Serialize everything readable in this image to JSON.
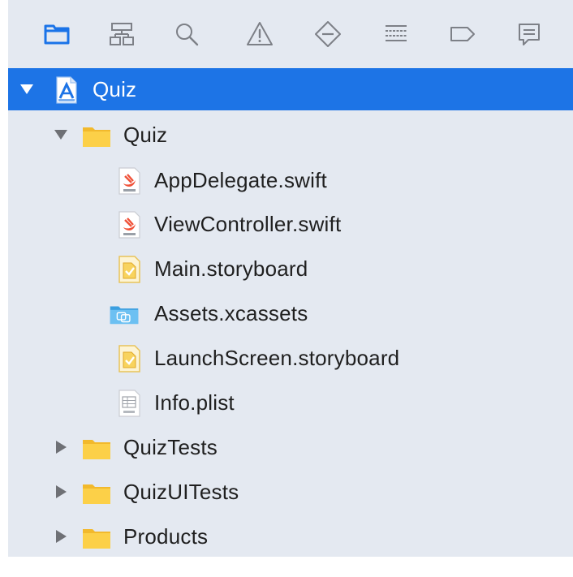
{
  "toolbar": {
    "tabs": [
      {
        "icon": "folder-icon",
        "active": true
      },
      {
        "icon": "hierarchy-icon",
        "active": false
      },
      {
        "icon": "search-icon",
        "active": false
      },
      {
        "icon": "warning-icon",
        "active": false
      },
      {
        "icon": "test-diamond-icon",
        "active": false
      },
      {
        "icon": "debug-list-icon",
        "active": false
      },
      {
        "icon": "breakpoint-icon",
        "active": false
      },
      {
        "icon": "report-message-icon",
        "active": false
      }
    ],
    "active_color": "#1a73e8",
    "inactive_color": "#7d8087"
  },
  "tree": {
    "project": {
      "label": "Quiz",
      "icon": "xcode-project-icon",
      "expanded": true,
      "selected": true
    },
    "group": {
      "label": "Quiz",
      "icon": "folder-icon",
      "expanded": true
    },
    "files": [
      {
        "label": "AppDelegate.swift",
        "icon": "swift-file-icon"
      },
      {
        "label": "ViewController.swift",
        "icon": "swift-file-icon"
      },
      {
        "label": "Main.storyboard",
        "icon": "storyboard-file-icon"
      },
      {
        "label": "Assets.xcassets",
        "icon": "assets-folder-icon"
      },
      {
        "label": "LaunchScreen.storyboard",
        "icon": "storyboard-file-icon"
      },
      {
        "label": "Info.plist",
        "icon": "plist-file-icon"
      }
    ],
    "groups": [
      {
        "label": "QuizTests",
        "icon": "folder-icon",
        "expanded": false
      },
      {
        "label": "QuizUITests",
        "icon": "folder-icon",
        "expanded": false
      },
      {
        "label": "Products",
        "icon": "folder-icon",
        "expanded": false
      }
    ]
  },
  "colors": {
    "selection": "#1d74e6",
    "background": "#e4e9f1",
    "folder": "#f7c744"
  }
}
